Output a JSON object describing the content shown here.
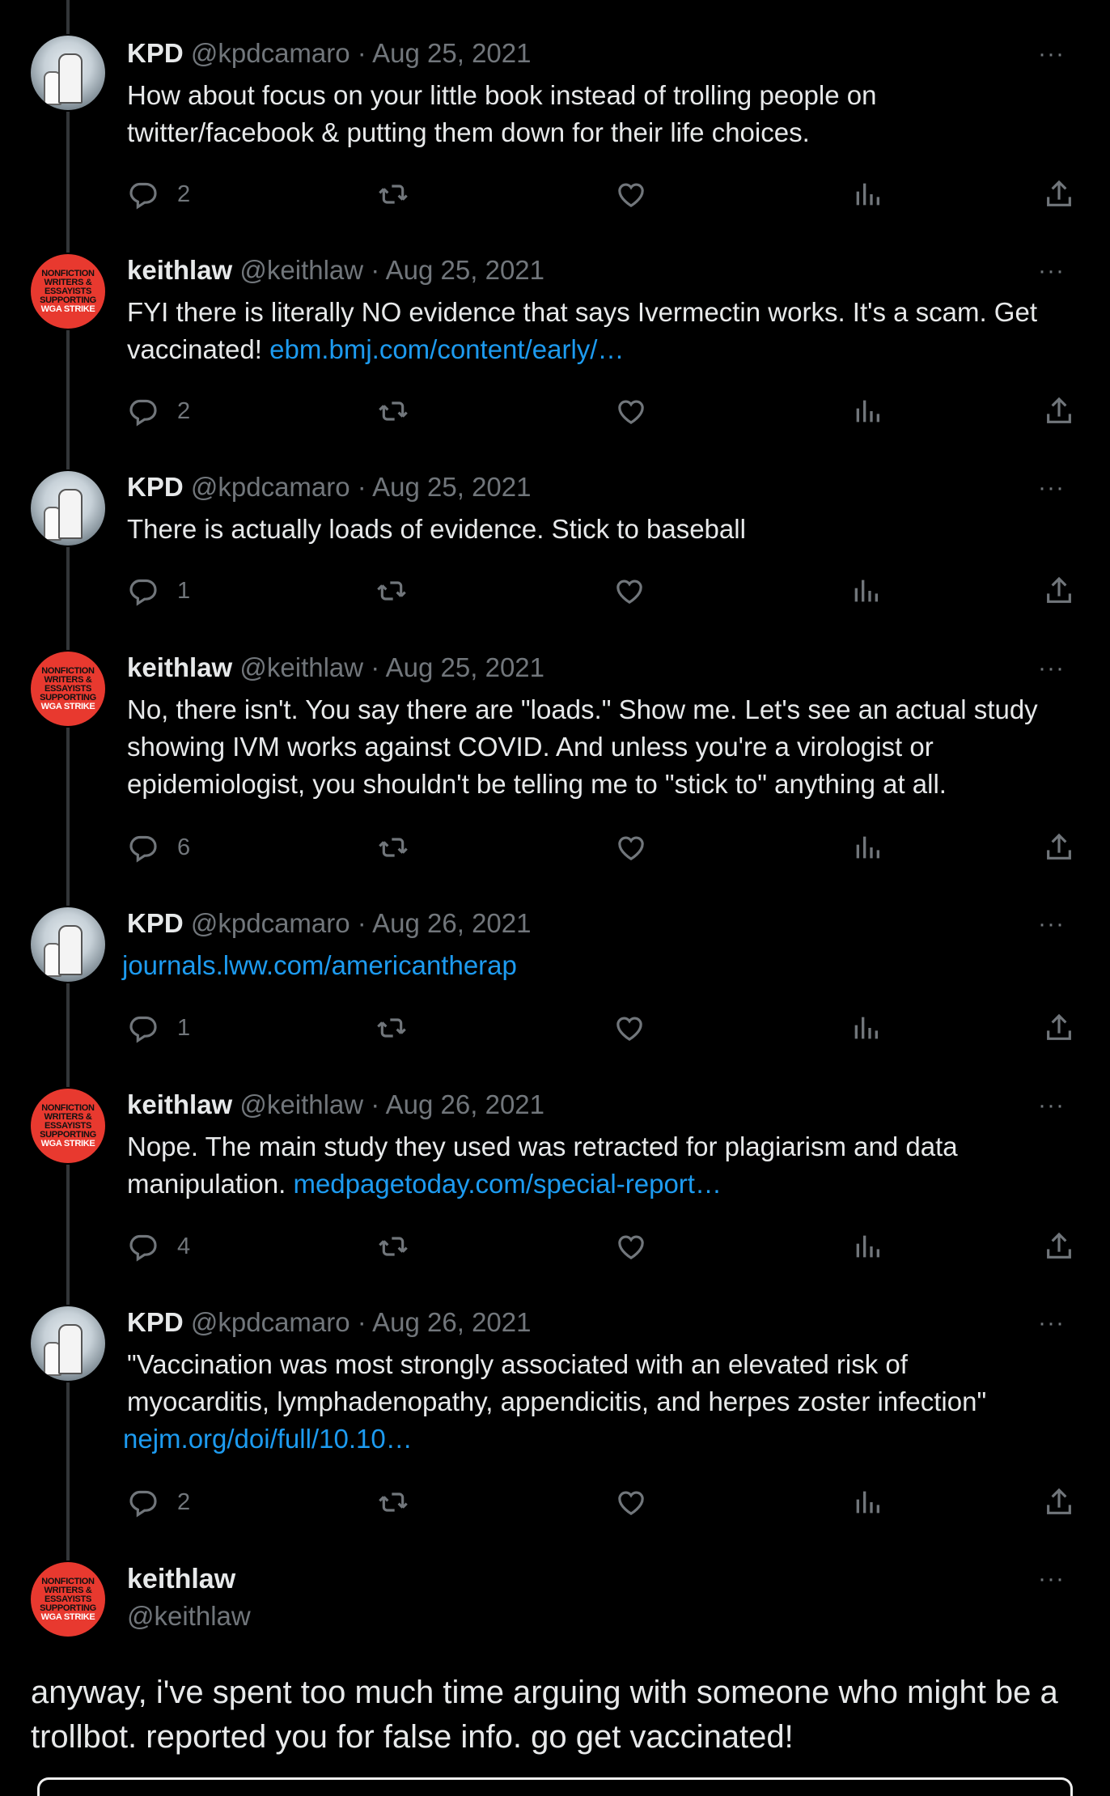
{
  "tweets": [
    {
      "name": "KPD",
      "handle": "@kpdcamaro",
      "date": "Aug 25, 2021",
      "text": "How about focus on your little book instead of trolling people on\ntwitter/facebook & putting them down for their life choices.",
      "link": "",
      "replies": "2"
    },
    {
      "name": "keithlaw",
      "handle": "@keithlaw",
      "date": "Aug 25, 2021",
      "text": "FYI there is literally NO evidence that says Ivermectin works. It's a scam. Get\nvaccinated! ",
      "link": "ebm.bmj.com/content/early/…",
      "replies": "2"
    },
    {
      "name": "KPD",
      "handle": "@kpdcamaro",
      "date": "Aug 25, 2021",
      "text": "There is actually loads of evidence. Stick to baseball",
      "link": "",
      "replies": "1"
    },
    {
      "name": "keithlaw",
      "handle": "@keithlaw",
      "date": "Aug 25, 2021",
      "text": "No, there isn't. You say there are \"loads.\" Show me. Let's see an actual study\nshowing IVM works against COVID. And unless you're a virologist or\nepidemiologist, you shouldn't be telling me to \"stick to\" anything at all.",
      "link": "",
      "replies": "6"
    },
    {
      "name": "KPD",
      "handle": "@kpdcamaro",
      "date": "Aug 26, 2021",
      "text": "",
      "link": "journals.lww.com/americantherap",
      "replies": "1"
    },
    {
      "name": "keithlaw",
      "handle": "@keithlaw",
      "date": "Aug 26, 2021",
      "text": "Nope. The main study they used was retracted for plagiarism and data\nmanipulation. ",
      "link": "medpagetoday.com/special-report…",
      "replies": "4"
    },
    {
      "name": "KPD",
      "handle": "@kpdcamaro",
      "date": "Aug 26, 2021",
      "text": "\"Vaccination was most strongly associated with an elevated risk of\nmyocarditis, lymphadenopathy, appendicitis, and herpes zoster infection\"\n",
      "link": "nejm.org/doi/full/10.10…",
      "replies": "2"
    }
  ],
  "final": {
    "name": "keithlaw",
    "handle": "@keithlaw",
    "text": "anyway, i've spent too much time arguing with someone who might be a trollbot. reported you for false info. go get vaccinated!"
  },
  "avatar_kl_lines": [
    "NONFICTION",
    "WRITERS &",
    "ESSAYISTS",
    "SUPPORTING",
    "WGA STRIKE"
  ],
  "separator": "·",
  "more_glyph": "···",
  "colors": {
    "background": "#000000",
    "text": "#e7e9ea",
    "muted": "#71767b",
    "link": "#1d9bf0",
    "avatar_red": "#e8392f"
  }
}
